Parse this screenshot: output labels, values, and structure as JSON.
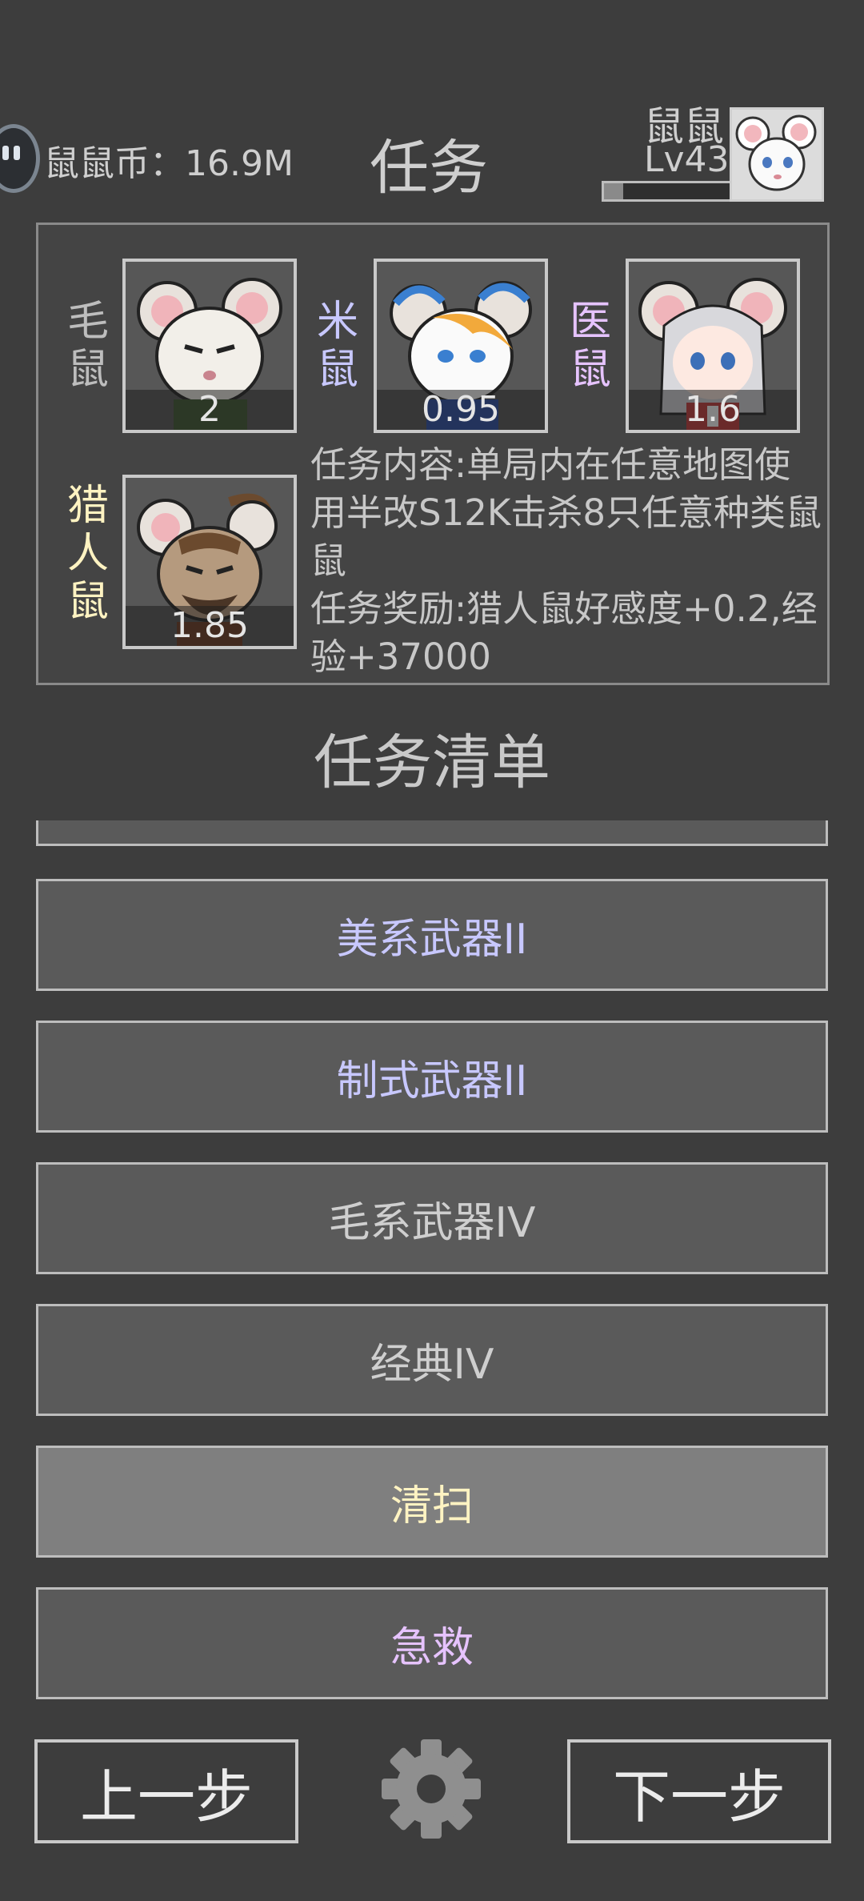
{
  "header": {
    "coin_text": "鼠鼠币：16.9M",
    "title": "任务",
    "player_name": "鼠鼠",
    "player_level": "Lv43",
    "xp_progress": 0.15
  },
  "characters": [
    {
      "name": "毛鼠",
      "affinity": "2",
      "name_color": "#bdbdbd"
    },
    {
      "name": "米鼠",
      "affinity": "0.95",
      "name_color": "#c8c8ff"
    },
    {
      "name": "医鼠",
      "affinity": "1.6",
      "name_color": "#e6c3ff"
    },
    {
      "name": "猎人鼠",
      "affinity": "1.85",
      "name_color": "#fff3c2"
    }
  ],
  "task": {
    "description": "任务内容:单局内在任意地图使用半改S12K击杀8只任意种类鼠鼠",
    "reward": "任务奖励:猎人鼠好感度+0.2,经验+37000"
  },
  "list_title": "任务清单",
  "task_list": [
    {
      "label": "",
      "color": "#c9c9c9"
    },
    {
      "label": "美系武器II",
      "color": "#c8c8ff"
    },
    {
      "label": "制式武器II",
      "color": "#c8c8ff"
    },
    {
      "label": "毛系武器IV",
      "color": "#cfcfcf"
    },
    {
      "label": "经典IV",
      "color": "#cfcfcf"
    },
    {
      "label": "清扫",
      "color": "#fff3c2"
    },
    {
      "label": "急救",
      "color": "#e6c3ff"
    }
  ],
  "nav": {
    "prev": "上一步",
    "next": "下一步"
  },
  "icons": {
    "coin": "mouse-coin-icon",
    "settings": "gear-icon"
  }
}
